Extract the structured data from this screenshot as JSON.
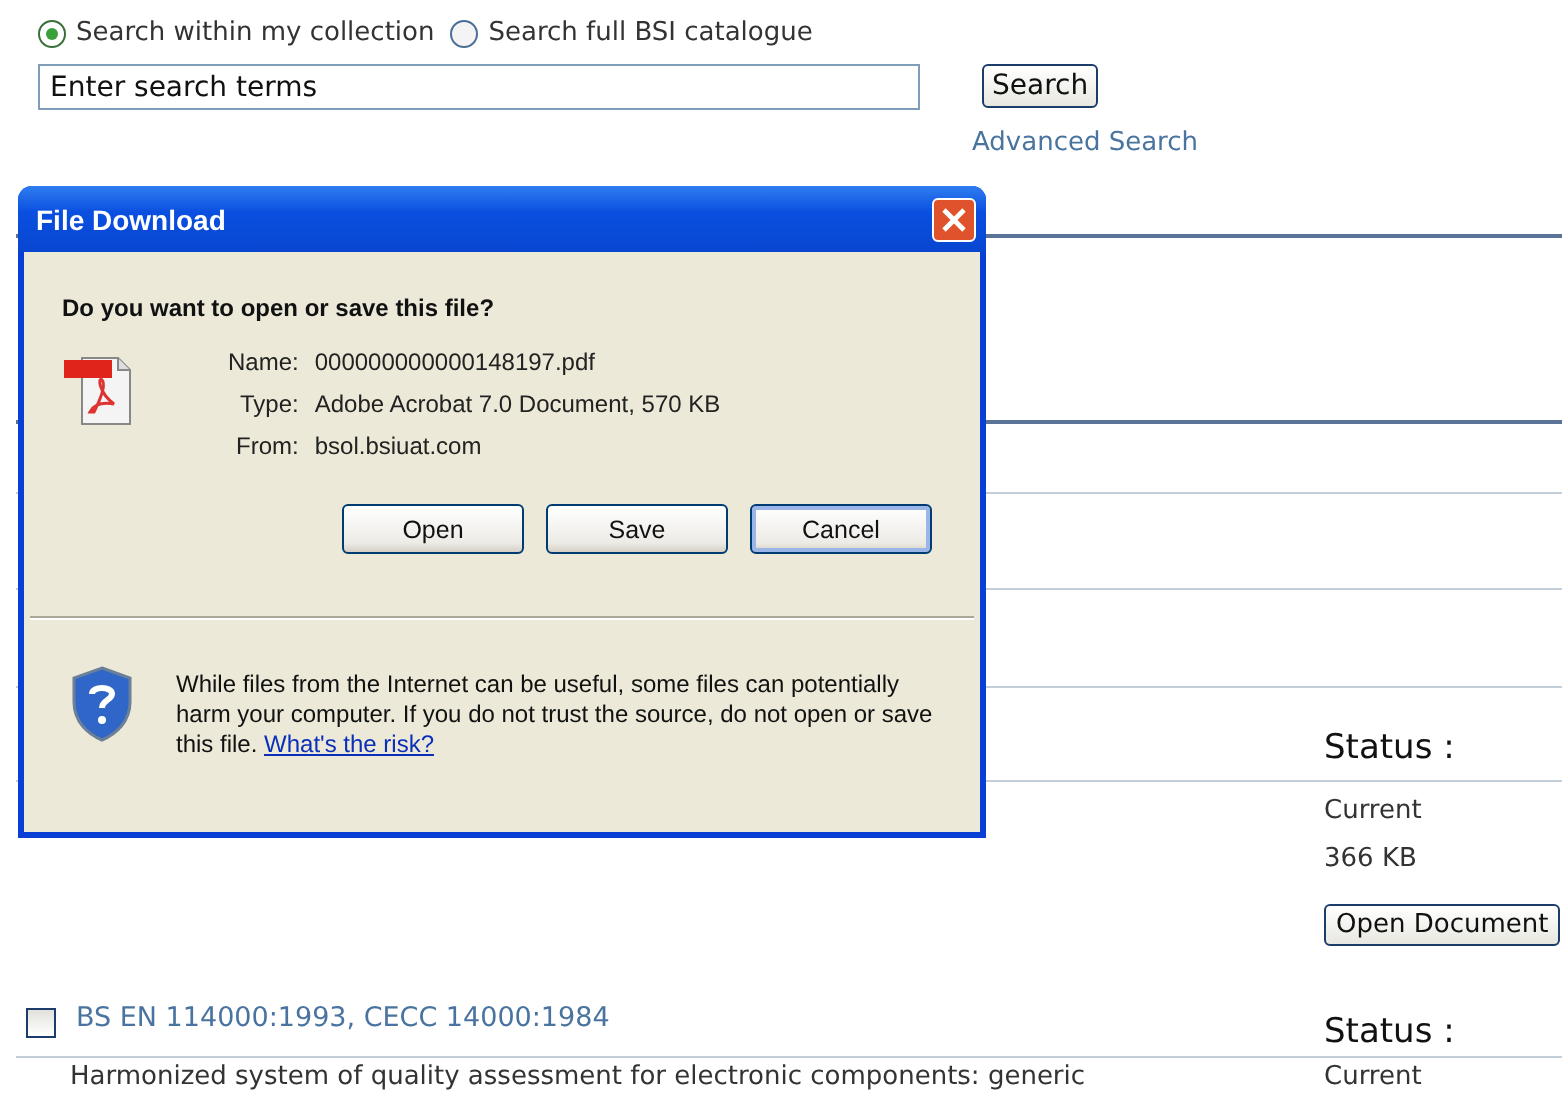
{
  "search_scope": [
    {
      "label": "Search within my collection",
      "selected": true
    },
    {
      "label": "Search full BSI catalogue",
      "selected": false
    }
  ],
  "search": {
    "placeholder": "Enter search terms",
    "button": "Search",
    "advanced_link": "Advanced Search"
  },
  "results": [
    {
      "status_label": "Status :",
      "status": "Current",
      "size": "366 KB",
      "button": "Open Document"
    },
    {
      "title": "BS EN 114000:1993, CECC 14000:1984",
      "checked": false,
      "status_label": "Status :",
      "status": "Current",
      "description": "Harmonized system of quality assessment for electronic components: generic"
    }
  ],
  "dialog": {
    "title": "File Download",
    "question": "Do you want to open or save this file?",
    "fields": [
      {
        "label": "Name:",
        "value": "000000000000148197.pdf"
      },
      {
        "label": "Type:",
        "value": "Adobe Acrobat 7.0 Document, 570 KB"
      },
      {
        "label": "From:",
        "value": "bsol.bsiuat.com"
      }
    ],
    "buttons": [
      {
        "label": "Open",
        "default": false
      },
      {
        "label": "Save",
        "default": false
      },
      {
        "label": "Cancel",
        "default": true
      }
    ],
    "warning": "While files from the Internet can be useful, some files can potentially harm your computer. If you do not trust the source, do not open or save this file.",
    "warning_link": "What's the risk?"
  }
}
